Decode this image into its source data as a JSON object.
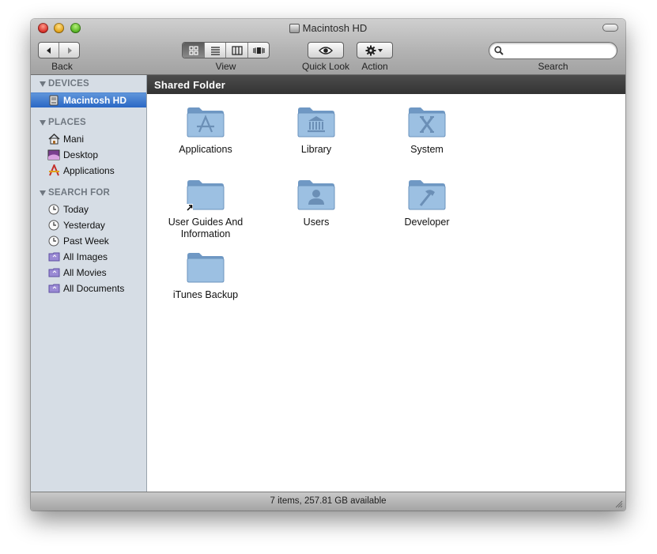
{
  "window": {
    "title": "Macintosh HD"
  },
  "toolbar": {
    "back_label": "Back",
    "view_label": "View",
    "quicklook_label": "Quick Look",
    "action_label": "Action",
    "search_label": "Search",
    "search_value": "",
    "active_view": "icon"
  },
  "sidebar": {
    "devices": {
      "header": "DEVICES",
      "items": [
        {
          "label": "Macintosh HD",
          "icon": "hard-drive-icon",
          "selected": true
        }
      ]
    },
    "places": {
      "header": "PLACES",
      "items": [
        {
          "label": "Mani",
          "icon": "home-icon"
        },
        {
          "label": "Desktop",
          "icon": "desktop-icon"
        },
        {
          "label": "Applications",
          "icon": "applications-icon"
        }
      ]
    },
    "search_for": {
      "header": "SEARCH FOR",
      "items": [
        {
          "label": "Today",
          "icon": "clock-icon"
        },
        {
          "label": "Yesterday",
          "icon": "clock-icon"
        },
        {
          "label": "Past Week",
          "icon": "clock-icon"
        },
        {
          "label": "All Images",
          "icon": "smart-folder-icon"
        },
        {
          "label": "All Movies",
          "icon": "smart-folder-icon"
        },
        {
          "label": "All Documents",
          "icon": "smart-folder-icon"
        }
      ]
    }
  },
  "pathbar": {
    "title": "Shared Folder"
  },
  "content": {
    "items": [
      {
        "label": "Applications",
        "icon": "applications-folder-icon"
      },
      {
        "label": "Library",
        "icon": "library-folder-icon"
      },
      {
        "label": "System",
        "icon": "system-folder-icon"
      },
      {
        "label": "User Guides And Information",
        "icon": "alias-folder-icon"
      },
      {
        "label": "Users",
        "icon": "users-folder-icon"
      },
      {
        "label": "Developer",
        "icon": "developer-folder-icon"
      },
      {
        "label": "iTunes Backup",
        "icon": "folder-icon"
      }
    ]
  },
  "status": {
    "text": "7 items, 257.81 GB available"
  },
  "colors": {
    "selection": "#3a76cf",
    "sidebar": "#d6dde5",
    "folder": "#8db4dc",
    "pathbar": "#3d3d3d"
  }
}
